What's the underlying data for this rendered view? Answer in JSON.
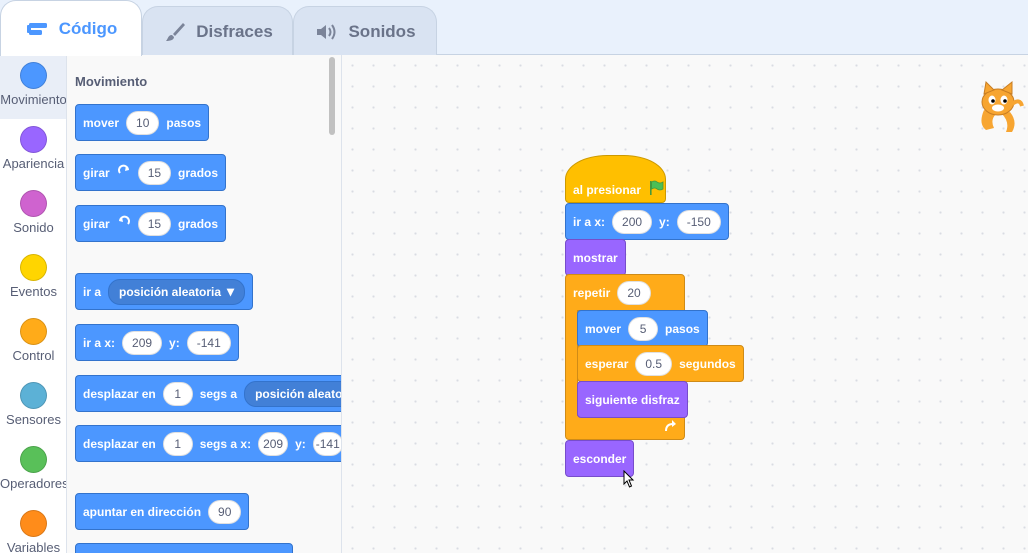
{
  "tabs": {
    "code": "Código",
    "costumes": "Disfraces",
    "sounds": "Sonidos"
  },
  "categories": [
    {
      "label": "Movimiento",
      "color": "#4c97ff"
    },
    {
      "label": "Apariencia",
      "color": "#9966ff"
    },
    {
      "label": "Sonido",
      "color": "#cf63cf"
    },
    {
      "label": "Eventos",
      "color": "#ffd500"
    },
    {
      "label": "Control",
      "color": "#ffab19"
    },
    {
      "label": "Sensores",
      "color": "#5cb1d6"
    },
    {
      "label": "Operadores",
      "color": "#59c059"
    },
    {
      "label": "Variables",
      "color": "#ff8c1a"
    }
  ],
  "palette": {
    "title": "Movimiento",
    "move": {
      "label": "mover",
      "value": "10",
      "suffix": "pasos"
    },
    "turn_right": {
      "label": "girar",
      "value": "15",
      "suffix": "grados",
      "icon": "rotate-right-icon"
    },
    "turn_left": {
      "label": "girar",
      "value": "15",
      "suffix": "grados",
      "icon": "rotate-left-icon"
    },
    "goto": {
      "label": "ir a",
      "menu": "posición aleatoria"
    },
    "goto_xy": {
      "label": "ir a x:",
      "x": "209",
      "ylabel": "y:",
      "y": "-141"
    },
    "glide": {
      "label": "desplazar en",
      "value": "1",
      "mid": "segs a",
      "menu": "posición aleatoria"
    },
    "glide_xy": {
      "label": "desplazar en",
      "value": "1",
      "mid": "segs a x:",
      "x": "209",
      "ylabel": "y:",
      "y": "-141"
    },
    "point": {
      "label": "apuntar en dirección",
      "value": "90"
    }
  },
  "script": {
    "flag": {
      "label": "al presionar",
      "icon": "green-flag-icon"
    },
    "goto_xy": {
      "label": "ir a x:",
      "x": "200",
      "ylabel": "y:",
      "y": "-150"
    },
    "show": {
      "label": "mostrar"
    },
    "repeat": {
      "label": "repetir",
      "value": "20",
      "icon": "loop-arrow-icon"
    },
    "move": {
      "label": "mover",
      "value": "5",
      "suffix": "pasos"
    },
    "wait": {
      "label": "esperar",
      "value": "0.5",
      "suffix": "segundos"
    },
    "next_costume": {
      "label": "siguiente disfraz"
    },
    "hide": {
      "label": "esconder"
    }
  }
}
